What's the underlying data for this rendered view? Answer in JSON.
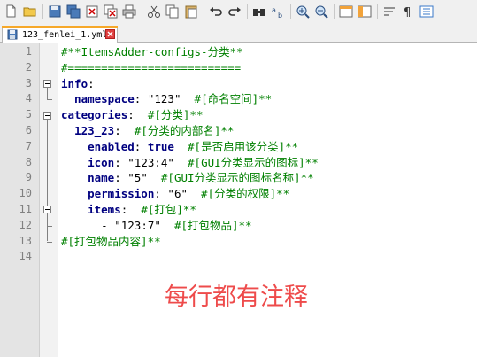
{
  "toolbar": {
    "buttons": [
      "new-file-icon",
      "open-file-icon",
      "save-icon",
      "save-all-icon",
      "close-icon",
      "close-all-icon",
      "print-icon",
      "cut-icon",
      "copy-icon",
      "paste-icon",
      "undo-icon",
      "redo-icon",
      "find-icon",
      "replace-icon",
      "zoom-in-icon",
      "zoom-out-icon",
      "sync-v-icon",
      "sync-h-icon",
      "word-wrap-icon",
      "show-all-chars-icon",
      "indent-guide-icon"
    ]
  },
  "tab": {
    "label": "123_fenlei_1.yml",
    "accent": "#f6a829"
  },
  "editor": {
    "lines": [
      {
        "n": "1",
        "parts": [
          {
            "t": "#**ItemsAdder-configs-分类**",
            "c": "cm"
          }
        ]
      },
      {
        "n": "2",
        "parts": [
          {
            "t": "#==========================",
            "c": "cm"
          }
        ]
      },
      {
        "n": "3",
        "parts": [
          {
            "t": "info",
            "c": "key"
          },
          {
            "t": ":",
            "c": "plain"
          }
        ]
      },
      {
        "n": "4",
        "parts": [
          {
            "t": "  namespace",
            "c": "key"
          },
          {
            "t": ": ",
            "c": "plain"
          },
          {
            "t": "\"123\"",
            "c": "str"
          },
          {
            "t": "  #[命名空间]**",
            "c": "cm"
          }
        ]
      },
      {
        "n": "5",
        "parts": [
          {
            "t": "categories",
            "c": "key"
          },
          {
            "t": ":  ",
            "c": "plain"
          },
          {
            "t": "#[分类]**",
            "c": "cm"
          }
        ]
      },
      {
        "n": "6",
        "parts": [
          {
            "t": "  123_23",
            "c": "key"
          },
          {
            "t": ":  ",
            "c": "plain"
          },
          {
            "t": "#[分类的内部名]**",
            "c": "cm"
          }
        ]
      },
      {
        "n": "7",
        "parts": [
          {
            "t": "    enabled",
            "c": "key"
          },
          {
            "t": ": ",
            "c": "plain"
          },
          {
            "t": "true",
            "c": "key"
          },
          {
            "t": "  #[是否启用该分类]**",
            "c": "cm"
          }
        ]
      },
      {
        "n": "8",
        "parts": [
          {
            "t": "    icon",
            "c": "key"
          },
          {
            "t": ": ",
            "c": "plain"
          },
          {
            "t": "\"123:4\"",
            "c": "str"
          },
          {
            "t": "  #[GUI分类显示的图标]**",
            "c": "cm"
          }
        ]
      },
      {
        "n": "9",
        "parts": [
          {
            "t": "    name",
            "c": "key"
          },
          {
            "t": ": ",
            "c": "plain"
          },
          {
            "t": "\"5\"",
            "c": "str"
          },
          {
            "t": "  #[GUI分类显示的图标名称]**",
            "c": "cm"
          }
        ]
      },
      {
        "n": "10",
        "parts": [
          {
            "t": "    permission",
            "c": "key"
          },
          {
            "t": ": ",
            "c": "plain"
          },
          {
            "t": "\"6\"",
            "c": "str"
          },
          {
            "t": "  #[分类的权限]**",
            "c": "cm"
          }
        ]
      },
      {
        "n": "11",
        "parts": [
          {
            "t": "    items",
            "c": "key"
          },
          {
            "t": ":  ",
            "c": "plain"
          },
          {
            "t": "#[打包]**",
            "c": "cm"
          }
        ]
      },
      {
        "n": "12",
        "parts": [
          {
            "t": "      - ",
            "c": "plain"
          },
          {
            "t": "\"123:7\"",
            "c": "str"
          },
          {
            "t": "  #[打包物品]**",
            "c": "cm"
          }
        ]
      },
      {
        "n": "13",
        "parts": [
          {
            "t": "#[打包物品内容]**",
            "c": "cm"
          }
        ]
      },
      {
        "n": "14",
        "parts": []
      }
    ]
  },
  "annotation": {
    "text": "每行都有注释",
    "color": "#ee4b4b"
  }
}
